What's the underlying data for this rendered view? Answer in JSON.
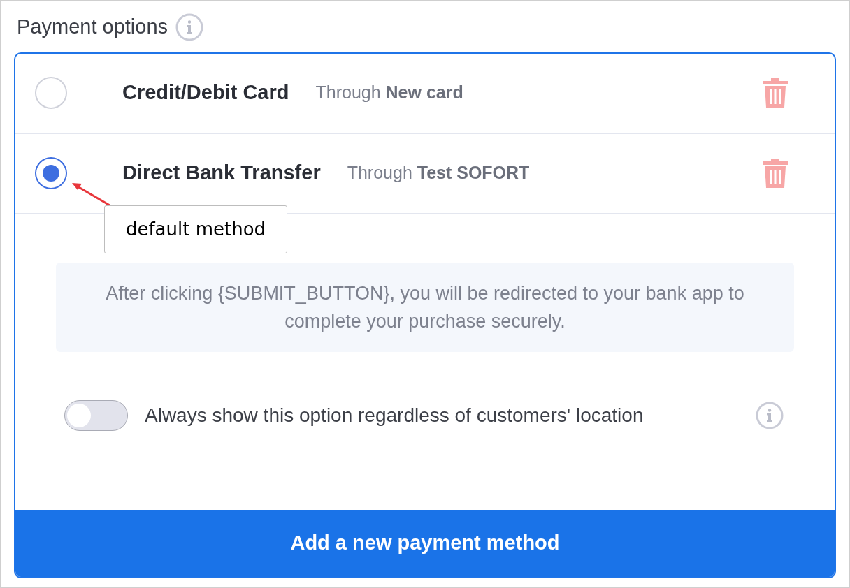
{
  "title": "Payment options",
  "methods": [
    {
      "name": "Credit/Debit Card",
      "through": "Through **New card**",
      "selected": false
    },
    {
      "name": "Direct Bank Transfer",
      "through": "Through **Test SOFORT**",
      "selected": true
    }
  ],
  "annotation": "default method",
  "notice": "After clicking {SUBMIT_BUTTON}, you will be redirected to your bank app to complete your purchase securely.",
  "toggle": {
    "label": "Always show this option regardless of customers' location",
    "on": false
  },
  "add_button": "Add a new payment method"
}
